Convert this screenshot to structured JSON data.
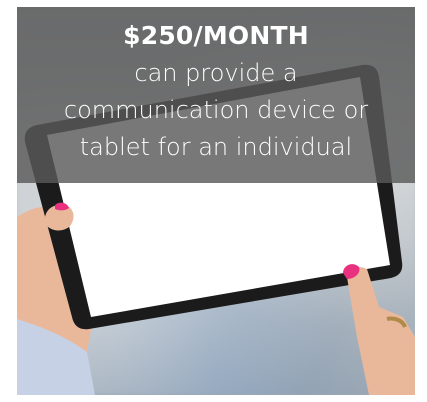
{
  "promo": {
    "headline": "$250/MONTH",
    "lines": [
      "can provide a",
      "communication device or",
      "tablet for an individual"
    ]
  },
  "colors": {
    "overlay": "#5a5a5a",
    "nail_polish": "#e8327f",
    "tablet_bezel": "#1b1b1b"
  },
  "image": {
    "subject": "hands-holding-tablet-icon"
  }
}
